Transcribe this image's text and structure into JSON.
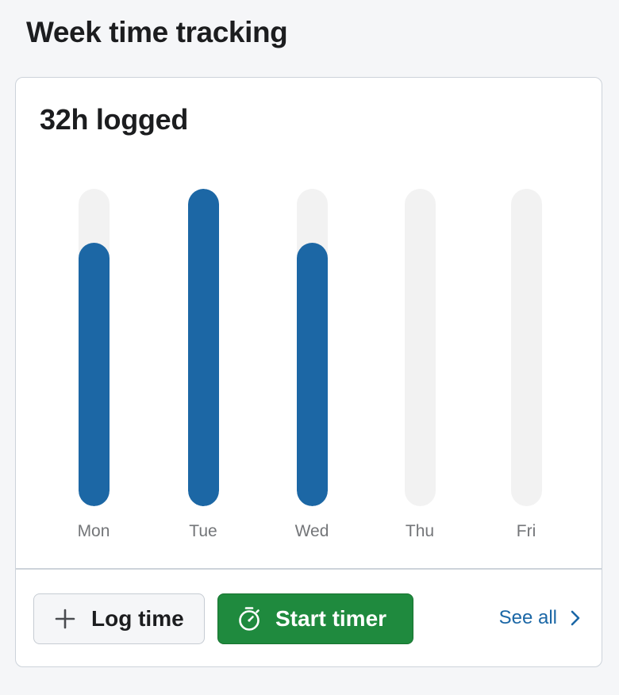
{
  "page": {
    "title": "Week time tracking"
  },
  "card": {
    "total_label": "32h logged",
    "actions": {
      "log_time_label": "Log time",
      "log_time_icon": "plus-icon",
      "start_timer_label": "Start timer",
      "start_timer_icon": "stopwatch-icon",
      "see_all_label": "See all",
      "see_all_icon": "chevron-right-icon"
    }
  },
  "colors": {
    "bar_fill": "#1c67a5",
    "bar_track": "#f2f2f2",
    "primary_button": "#1f8a3e",
    "link": "#1b67a6"
  },
  "chart_data": {
    "type": "bar",
    "title": "32h logged",
    "categories": [
      "Mon",
      "Tue",
      "Wed",
      "Thu",
      "Fri"
    ],
    "values": [
      0.83,
      1.0,
      0.83,
      0,
      0
    ],
    "xlabel": "",
    "ylabel": "",
    "ylim": [
      0,
      1
    ],
    "grid": false
  }
}
